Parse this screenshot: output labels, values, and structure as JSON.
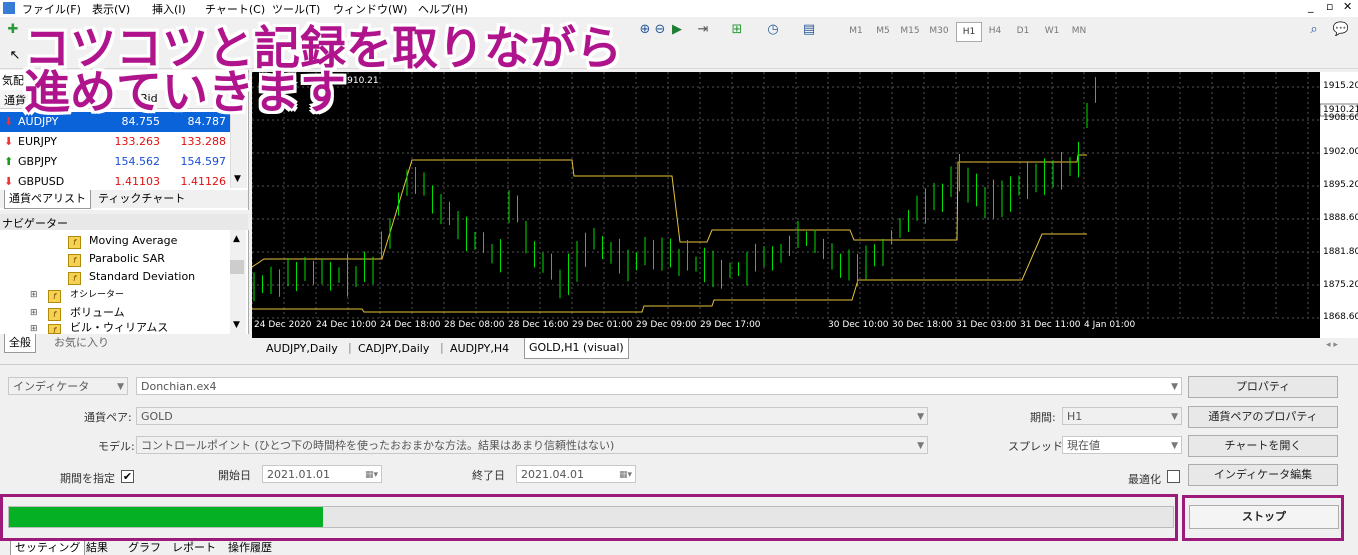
{
  "menu": [
    "ファイル(F)",
    "表示(V)",
    "挿入(I)",
    "チャート(C)",
    "ツール(T)",
    "ウィンドウ(W)",
    "ヘルプ(H)"
  ],
  "timeframes": [
    "M1",
    "M5",
    "M15",
    "M30",
    "H1",
    "H4",
    "D1",
    "W1",
    "MN"
  ],
  "active_timeframe": "H1",
  "overlay": {
    "line1": "コツコツと記録を取りながら",
    "line2": "進めていきます"
  },
  "market_watch": {
    "header_partial": "気配",
    "col_symbol": "通貨",
    "col_bid": "Bid",
    "rows": [
      {
        "symbol": "AUDJPY",
        "bid": "84.755",
        "ask": "84.787",
        "dir": "down"
      },
      {
        "symbol": "EURJPY",
        "bid": "133.263",
        "ask": "133.288",
        "dir": "down"
      },
      {
        "symbol": "GBPJPY",
        "bid": "154.562",
        "ask": "154.597",
        "dir": "up"
      },
      {
        "symbol": "GBPUSD",
        "bid": "1.41103",
        "ask": "1.41126",
        "dir": "down"
      }
    ],
    "tabs": [
      "通貨ペアリスト",
      "ティックチャート"
    ]
  },
  "navigator": {
    "title": "ナビゲーター",
    "items": [
      "Moving Average",
      "Parabolic SAR",
      "Standard Deviation",
      "オシレーター",
      "ボリューム",
      "ビル・ウィリアムス"
    ],
    "tabs": [
      "全般",
      "お気に入り"
    ]
  },
  "chart": {
    "ohlc_text": "G... 3.41 1909.84 1910.21",
    "current_price": "1910.21",
    "price_ticks": [
      "1915.20",
      "1908.60",
      "1902.00",
      "1895.20",
      "1888.60",
      "1881.80",
      "1875.20",
      "1868.60"
    ],
    "time_ticks": [
      "24 Dec 2020",
      "24 Dec 10:00",
      "24 Dec 18:00",
      "28 Dec 08:00",
      "28 Dec 16:00",
      "29 Dec 01:00",
      "29 Dec 09:00",
      "29 Dec 17:00",
      "30 Dec 10:00",
      "30 Dec 18:00",
      "31 Dec 03:00",
      "31 Dec 11:00",
      "4 Jan 01:00"
    ],
    "colors": {
      "candle": "#00e000",
      "channel": "#e6c23a",
      "grid": "#555555"
    }
  },
  "chart_tabs": [
    "AUDJPY,Daily",
    "CADJPY,Daily",
    "AUDJPY,H4",
    "GOLD,H1 (visual)"
  ],
  "tester": {
    "type_value": "インディケータ",
    "expert_value": "Donchian.ex4",
    "symbol_label": "通貨ペア:",
    "symbol_value": "GOLD",
    "model_label": "モデル:",
    "model_value": "コントロールポイント (ひとつ下の時間枠を使ったおおまかな方法。結果はあまり信頼性はない)",
    "period_label": "期間:",
    "period_value": "H1",
    "spread_label": "スプレッド:",
    "spread_value": "現在値",
    "use_date_label": "期間を指定",
    "use_date_checked": "✔",
    "start_label": "開始日",
    "start_value": "2021.01.01",
    "end_label": "終了日",
    "end_value": "2021.04.01",
    "optimize_label": "最適化",
    "buttons": {
      "properties": "プロパティ",
      "symbol_props": "通貨ペアのプロパティ",
      "open_chart": "チャートを開く",
      "edit_indicator": "インディケータ編集",
      "stop": "ストップ"
    },
    "progress": 0.27,
    "bottom_tabs": [
      "セッティング",
      "結果",
      "グラフ",
      "レポート",
      "操作履歴"
    ]
  }
}
